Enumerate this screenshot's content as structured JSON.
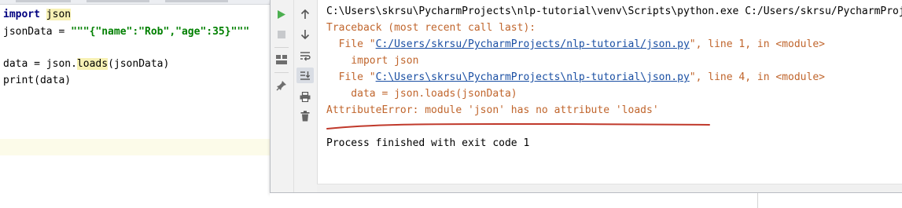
{
  "editor": {
    "lines": [
      {
        "kw": "import",
        "rest": "json"
      },
      {
        "var": "jsonData = ",
        "str": "\"\"\"{\"name\":\"Rob\",\"age\":35}\"\"\""
      },
      {
        "text": ""
      },
      {
        "pre": "data = json.",
        "hl": "loads",
        "post": "(jsonData)"
      },
      {
        "text": "print(data)"
      }
    ]
  },
  "toolbar": {
    "run_icon": "run-icon",
    "stop_icon": "stop-icon",
    "layout_icon": "layout-icon",
    "pin_icon": "pin-icon",
    "scroll_up_icon": "arrow-up-icon",
    "scroll_down_icon": "arrow-down-icon",
    "soft_wrap_icon": "soft-wrap-icon",
    "scroll_to_end_icon": "scroll-to-end-icon",
    "print_icon": "print-icon",
    "trash_icon": "trash-icon"
  },
  "console": {
    "command": "C:\\Users\\skrsu\\PycharmProjects\\nlp-tutorial\\venv\\Scripts\\python.exe C:/Users/skrsu/PycharmProj",
    "traceback_header": "Traceback (most recent call last):",
    "frame1": {
      "prefix": "  File \"",
      "link": "C:/Users/skrsu/PycharmProjects/nlp-tutorial/json.py",
      "suffix": "\", line 1, in <module>",
      "code": "    import json"
    },
    "frame2": {
      "prefix": "  File \"",
      "link": "C:\\Users\\skrsu\\PycharmProjects\\nlp-tutorial\\json.py",
      "suffix": "\", line 4, in <module>",
      "code": "    data = json.loads(jsonData)"
    },
    "error": "AttributeError: module 'json' has no attribute 'loads'",
    "exit": "Process finished with exit code 1"
  },
  "colors": {
    "error_text": "#c0652c",
    "link_text": "#1a4fa3",
    "annotation_underline": "#c0392b",
    "run_green": "#4caf50"
  }
}
